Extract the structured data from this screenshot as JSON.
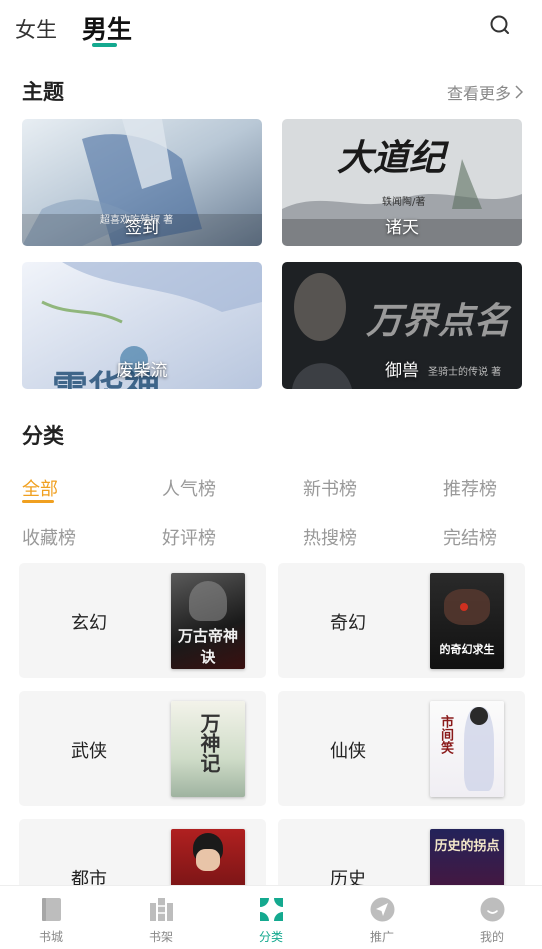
{
  "header": {
    "tab_female": "女生",
    "tab_male": "男生",
    "accent_color": "#14a98f"
  },
  "theme_section": {
    "title": "主题",
    "see_more": "查看更多",
    "cards": [
      {
        "label": "签到",
        "cover_caption": "超喜欢吃辣椒 著"
      },
      {
        "label": "诸天",
        "cover_title": "大道纪",
        "cover_caption": "轶闻陶/著"
      },
      {
        "label": "废柴流",
        "cover_title": "雷华神"
      },
      {
        "label": "御兽",
        "cover_title": "万界点名",
        "cover_caption": "圣骑士的传说 著"
      }
    ]
  },
  "category_section": {
    "title": "分类",
    "highlight_color": "#f0a020",
    "tabs": [
      "全部",
      "人气榜",
      "新书榜",
      "推荐榜",
      "收藏榜",
      "好评榜",
      "热搜榜",
      "完结榜"
    ],
    "cards": [
      {
        "name": "玄幻",
        "cover_title": "万古帝神诀"
      },
      {
        "name": "奇幻",
        "cover_title": "的奇幻求生"
      },
      {
        "name": "武侠",
        "cover_title": "万神记"
      },
      {
        "name": "仙侠",
        "cover_title": "市间笑"
      },
      {
        "name": "都市",
        "cover_title": ""
      },
      {
        "name": "历史",
        "cover_title": "历史的拐点"
      }
    ]
  },
  "bottom_nav": {
    "items": [
      {
        "label": "书城",
        "icon": "book-icon"
      },
      {
        "label": "书架",
        "icon": "bookshelf-icon"
      },
      {
        "label": "分类",
        "icon": "category-grid-icon"
      },
      {
        "label": "推广",
        "icon": "share-arrow-icon"
      },
      {
        "label": "我的",
        "icon": "profile-icon"
      }
    ]
  }
}
